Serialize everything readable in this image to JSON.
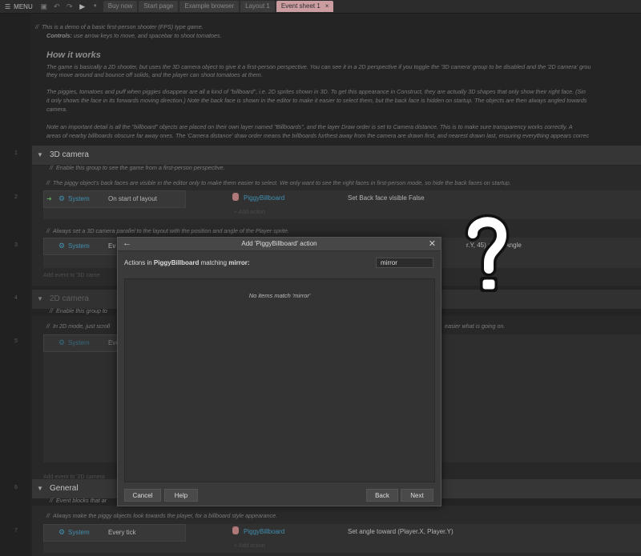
{
  "toolbar": {
    "menu_label": "MENU",
    "tabs": [
      "Buy now",
      "Start page",
      "Example browser",
      "Layout 1",
      "Event sheet 1"
    ],
    "close_glyph": "×"
  },
  "sheet": {
    "intro_line1": "This is a demo of a basic first-person shooter (FPS) type game.",
    "controls_bold": "Controls:",
    "controls_text": "use arrow keys to move, and spacebar to shoot tomatoes.",
    "how_title": "How it works",
    "p1a": "The game is basically a 2D shooter, but uses the 3D camera object to give it a first-person perspective. You can see it in a 2D perspective if you toggle the '3D camera' group to be disabled and the '2D camera' grou",
    "p1b": "they move around and bounce off solids, and the player can shoot tomatoes at them.",
    "p2a": "The piggies, tomatoes and puff when piggies disappear are all a kind of \"billboard\", i.e. 2D sprites shown in 3D. To get this appearance in Construct, they are actually 3D shapes that only show their right face. (Sin",
    "p2b": "it only shows the face in its forwards moving direction.) Note the back face is shown in the editor to make it easier to select them, but the back face is hidden on startup. The objects are then always angled towards",
    "p2c": "camera.",
    "p3a": "Note an important detail is all the \"billboard\" objects are placed on their own layer named \"Billboards\", and the layer Draw order is set to Camera distance. This is to make sure transparency works correctly. A",
    "p3b": "areas of nearby billboards obscure far away ones. The 'Camera distance' draw order means the billboards furthest away from the camera are drawn first, and nearest drawn last, ensuring everything appears correc",
    "group1_title": "3D camera",
    "group1_comment": "Enable this group to see the game from a first-person perspective.",
    "g1_c2": "The piggy object's back faces are visible in the editor only to make them easier to select. We only want to see the right faces in first-person mode, so hide the back faces on startup.",
    "ev1_sys": "System",
    "ev1_cond": "On start of layout",
    "ev1_obj": "PiggyBillboard",
    "ev1_act": "Set Back face visible False",
    "add_action": "+ Add action",
    "g1_c3": "Always set a 3D camera parallel to the layout with the position and angle of the Player sprite.",
    "ev2_sys": "System",
    "ev2_cond": "Ev",
    "ev2_act_tail": "r.Y, 45) angle        Angle",
    "add_event_3d": "Add event to '3D came",
    "group2_title": "2D camera",
    "g2_comment": "Enable this group to",
    "g2_c2": "In 2D mode, just scroll",
    "g2_c2_tail": "easier what is going on.",
    "ev3_sys": "System",
    "ev3_cond": "Eve",
    "add_event_2d": "Add event to '2D camera",
    "group3_title": "General",
    "g3_comment": "Event blocks that ar",
    "g3_c2": "Always make the piggy objects look towards the player, for a billboard style appearance.",
    "ev4_sys": "System",
    "ev4_cond": "Every tick",
    "ev4_obj": "PiggyBillboard",
    "ev4_act": "Set angle toward (Player.X, Player.Y)",
    "rows": [
      "1",
      "2",
      "3",
      "4",
      "5",
      "6",
      "7"
    ]
  },
  "dialog": {
    "title": "Add 'PiggyBillboard' action",
    "caption_prefix": "Actions in ",
    "caption_obj": "PiggyBillboard",
    "caption_mid": " matching ",
    "caption_term": "mirror:",
    "search_value": "mirror",
    "empty_message": "No items match 'mirror'",
    "btn_cancel": "Cancel",
    "btn_help": "Help",
    "btn_back": "Back",
    "btn_next": "Next"
  },
  "colors": {
    "accent": "#4aa3c8",
    "active_tab": "#e7b3b8"
  }
}
